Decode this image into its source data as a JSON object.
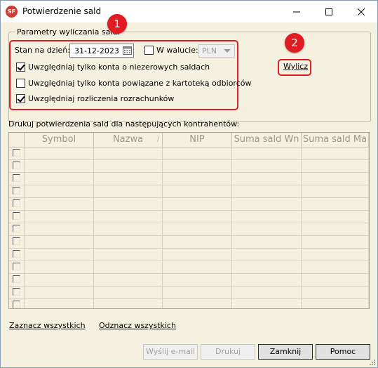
{
  "window": {
    "title": "Potwierdzenie sald",
    "icon_label": "SF",
    "icons": {
      "minimize": "minimize-icon",
      "maximize": "maximize-icon",
      "close": "close-icon"
    }
  },
  "group": {
    "legend": "Parametry wyliczania sald:",
    "date_label": "Stan na dzień:",
    "date_value": "31-12-2023",
    "currency_checkbox_label": "W walucie:",
    "currency_checked": false,
    "currency_value": "PLN",
    "checkboxes": [
      {
        "label": "Uwzględniaj tylko konta o niezerowych saldach",
        "checked": true
      },
      {
        "label": "Uwzględniaj tylko konta powiązane z kartoteką odbiorców",
        "checked": false
      },
      {
        "label": "Uwzględniaj rozliczenia rozrachunków",
        "checked": true
      }
    ],
    "compute_button": "Wylicz"
  },
  "annotations": {
    "badge1": "1",
    "badge2": "2",
    "color": "#e11b22"
  },
  "grid": {
    "caption": "Drukuj potwierdzenia sald dla następujących kontrahentów:",
    "columns": [
      "",
      "Symbol",
      "Nazwa",
      "NIP",
      "Suma sald Wn",
      "Suma sald Ma"
    ],
    "sorted_marker": "/",
    "empty_rows": 13
  },
  "links": {
    "select_all": "Zaznacz wszystkich",
    "deselect_all": "Odznacz wszystkich"
  },
  "buttons": {
    "email": "Wyślij e-mail",
    "print": "Drukuj",
    "close": "Zamknij",
    "help": "Pomoc"
  },
  "colors": {
    "background": "#f5f1e1",
    "accent_red": "#e11b22"
  }
}
